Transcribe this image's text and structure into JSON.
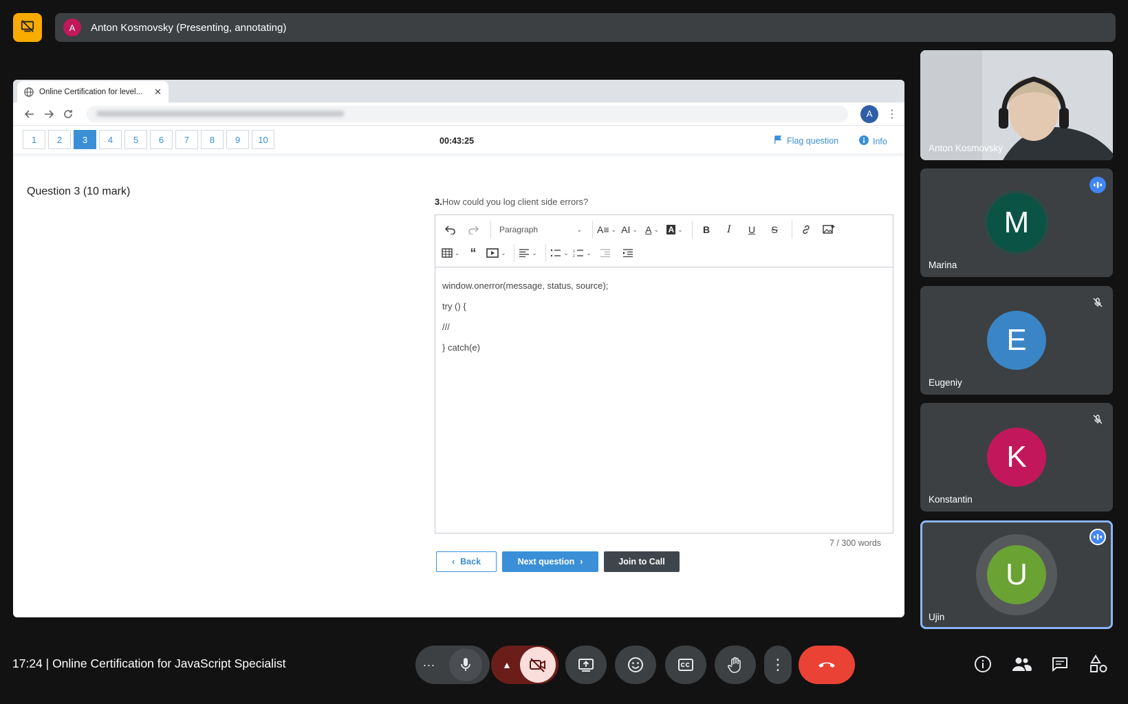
{
  "presenter": {
    "initial": "A",
    "label": "Anton Kosmovsky (Presenting, annotating)"
  },
  "browser": {
    "tab_title": "Online Certification for level...",
    "tab_close": "✕",
    "profile_initial": "A"
  },
  "exam": {
    "questions": [
      "1",
      "2",
      "3",
      "4",
      "5",
      "6",
      "7",
      "8",
      "9",
      "10"
    ],
    "active_question": "3",
    "timer": "00:43:25",
    "flag_label": "Flag question",
    "info_label": "Info",
    "title": "Question 3 (10 mark)",
    "question_number": "3.",
    "question_text": "How could you log client side errors?",
    "paragraph_label": "Paragraph",
    "answer_lines": [
      "window.onerror(message, status, source);",
      "try () {",
      "///",
      "} catch(e)"
    ],
    "word_count": "7 / 300 words",
    "back_label": "Back",
    "next_label": "Next question",
    "join_label": "Join to Call"
  },
  "participants": [
    {
      "name": "Anton Kosmovsky",
      "type": "video"
    },
    {
      "name": "Marina",
      "initial": "M",
      "color": "#0b5345",
      "status": "talking"
    },
    {
      "name": "Eugeniy",
      "initial": "E",
      "color": "#3a85c6",
      "status": "muted"
    },
    {
      "name": "Konstantin",
      "initial": "K",
      "color": "#c2185b",
      "status": "muted"
    },
    {
      "name": "Ujin",
      "initial": "U",
      "color": "#6aa233",
      "status": "talking",
      "selected": true
    }
  ],
  "meeting": {
    "info": "17:24 | Online Certification for JavaScript Specialist"
  },
  "colors": {
    "accent": "#3a8fd6",
    "present_button": "#f9ab00",
    "end_call": "#ea4335",
    "camera_off": "#f9dedc"
  }
}
